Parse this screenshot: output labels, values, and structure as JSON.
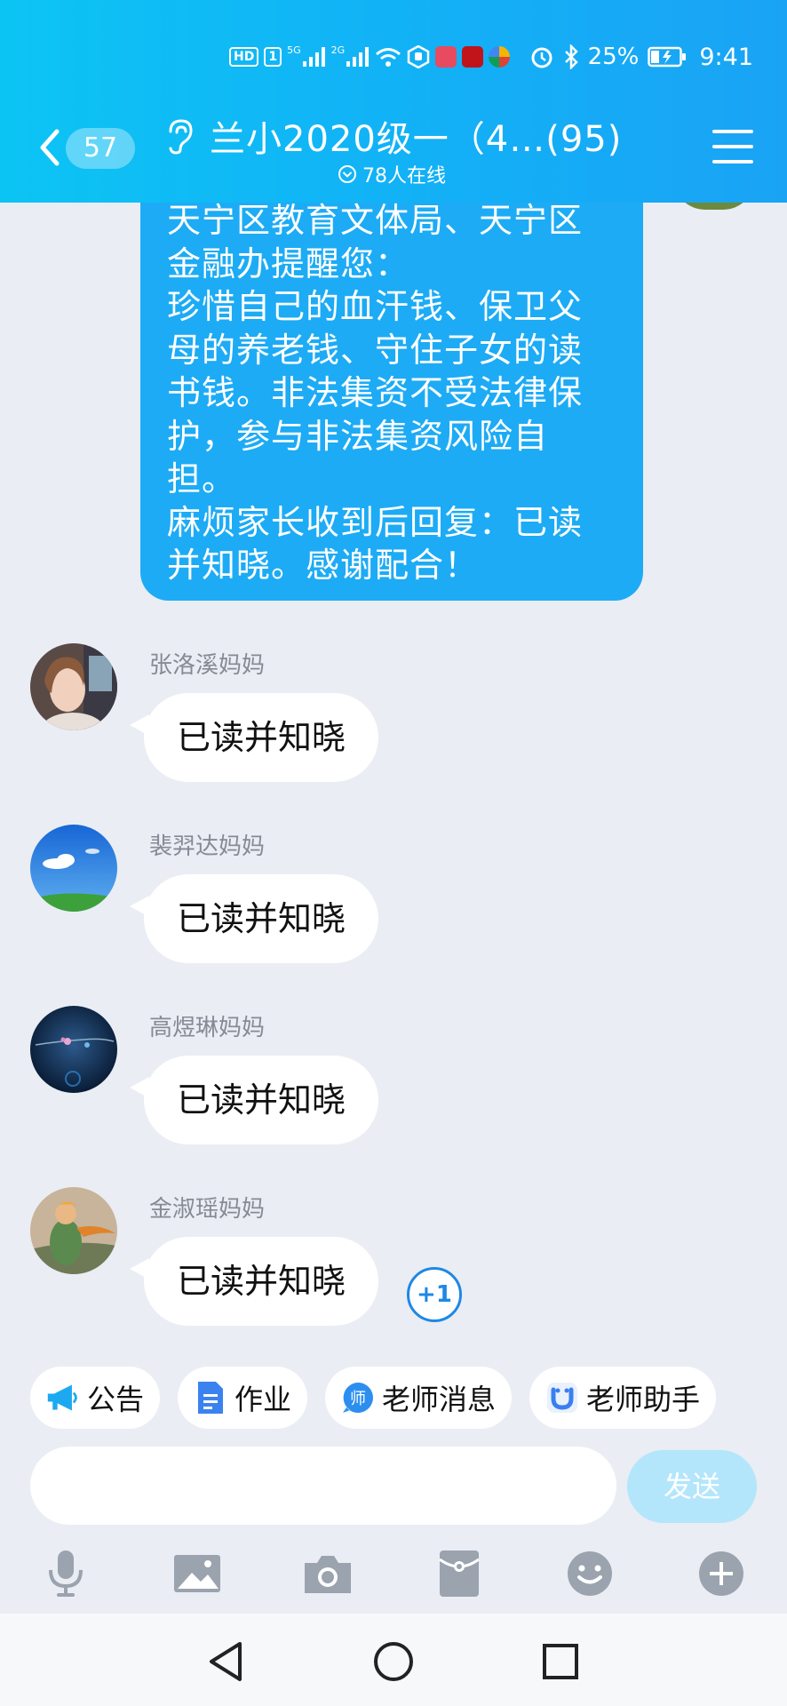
{
  "status_bar": {
    "hd": "HD",
    "sim": "1",
    "net1": "5G",
    "net2": "2G",
    "battery": "25%",
    "time": "9:41"
  },
  "header": {
    "unread_count": "57",
    "title": "兰小2020级一（4…(95)",
    "online": "78人在线",
    "colors": {
      "start": "#0cc4f4",
      "end": "#1aa3f5"
    }
  },
  "notice_message": {
    "text": "天宁区教育文体局、天宁区\n金融办提醒您：\n珍惜自己的血汗钱、保卫父\n母的养老钱、守住子女的读\n书钱。非法集资不受法律保\n护，参与非法集资风险自\n担。\n麻烦家长收到后回复：已读\n并知晓。感谢配合！",
    "bubble_color": "#1dabf5"
  },
  "messages": [
    {
      "sender": "张洛溪妈妈",
      "text": "已读并知晓",
      "avatar": "photo-avatar-woman"
    },
    {
      "sender": "裴羿达妈妈",
      "text": "已读并知晓",
      "avatar": "sky-avatar"
    },
    {
      "sender": "高煜琳妈妈",
      "text": "已读并知晓",
      "avatar": "night-flower-avatar"
    },
    {
      "sender": "金淑瑶妈妈",
      "text": "已读并知晓",
      "avatar": "little-prince-avatar"
    }
  ],
  "plus_one": "+1",
  "quick_actions": [
    {
      "label": "公告",
      "icon": "megaphone-icon"
    },
    {
      "label": "作业",
      "icon": "document-icon"
    },
    {
      "label": "老师消息",
      "icon": "teacher-icon"
    },
    {
      "label": "老师助手",
      "icon": "assistant-icon"
    }
  ],
  "input": {
    "placeholder": "",
    "send_label": "发送"
  },
  "toolbar": [
    "microphone-icon",
    "image-icon",
    "camera-icon",
    "red-packet-icon",
    "emoji-icon",
    "plus-icon"
  ],
  "navbar": [
    "back-triangle-icon",
    "home-circle-icon",
    "recents-square-icon"
  ]
}
